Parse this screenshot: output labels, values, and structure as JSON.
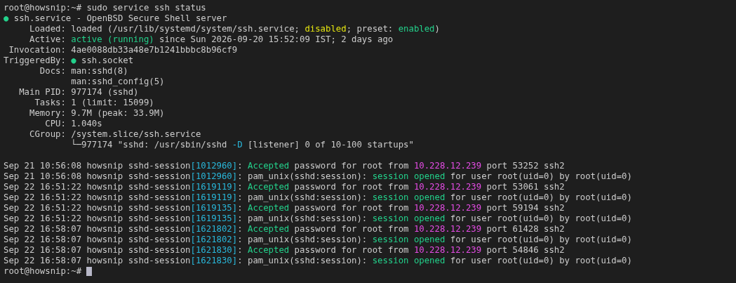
{
  "terminal": {
    "lines": [
      {
        "segments": [
          {
            "text": "root@howsnip:~# sudo service ssh status",
            "kind": "plain"
          }
        ]
      },
      {
        "segments": [
          {
            "text": "●",
            "kind": "ok"
          },
          {
            "text": " ssh.service - OpenBSD Secure Shell server",
            "kind": "plain"
          }
        ]
      },
      {
        "segments": [
          {
            "text": "     Loaded: loaded (/usr/lib/systemd/system/ssh.service; ",
            "kind": "plain"
          },
          {
            "text": "disabled",
            "kind": "warn"
          },
          {
            "text": "; preset: ",
            "kind": "plain"
          },
          {
            "text": "enabled",
            "kind": "ok"
          },
          {
            "text": ")",
            "kind": "plain"
          }
        ]
      },
      {
        "segments": [
          {
            "text": "     Active: ",
            "kind": "plain"
          },
          {
            "text": "active (running)",
            "kind": "ok"
          },
          {
            "text": " since Sun 2026-09-20 15:52:09 IST; 2 days ago",
            "kind": "plain"
          }
        ]
      },
      {
        "segments": [
          {
            "text": " Invocation: 4ae0088db33a48e7b1241bbbc8b96cf9",
            "kind": "plain"
          }
        ]
      },
      {
        "segments": [
          {
            "text": "TriggeredBy: ",
            "kind": "plain"
          },
          {
            "text": "●",
            "kind": "ok"
          },
          {
            "text": " ssh.socket",
            "kind": "plain"
          }
        ]
      },
      {
        "segments": [
          {
            "text": "       Docs: man:sshd(8)",
            "kind": "plain"
          }
        ]
      },
      {
        "segments": [
          {
            "text": "             man:sshd_config(5)",
            "kind": "plain"
          }
        ]
      },
      {
        "segments": [
          {
            "text": "   Main PID: 977174 (sshd)",
            "kind": "plain"
          }
        ]
      },
      {
        "segments": [
          {
            "text": "      Tasks: 1 (limit: 15099)",
            "kind": "plain"
          }
        ]
      },
      {
        "segments": [
          {
            "text": "     Memory: 9.7M (peak: 33.9M)",
            "kind": "plain"
          }
        ]
      },
      {
        "segments": [
          {
            "text": "        CPU: 1.040s",
            "kind": "plain"
          }
        ]
      },
      {
        "segments": [
          {
            "text": "     CGroup: /system.slice/ssh.service",
            "kind": "plain"
          }
        ]
      },
      {
        "segments": [
          {
            "text": "             └─977174 \"sshd: /usr/sbin/sshd ",
            "kind": "plain"
          },
          {
            "text": "-D",
            "kind": "pid"
          },
          {
            "text": " [listener] 0 of 10-100 startups\"",
            "kind": "plain"
          }
        ]
      }
    ],
    "log_lines": [
      {
        "segments": [
          {
            "text": "Sep 21 10:56:08 howsnip sshd-session",
            "kind": "plain"
          },
          {
            "text": "[1012960]",
            "kind": "pid"
          },
          {
            "text": ": ",
            "kind": "plain"
          },
          {
            "text": "Accepted",
            "kind": "ok"
          },
          {
            "text": " password for root from ",
            "kind": "plain"
          },
          {
            "text": "10.228.12.239",
            "kind": "addr"
          },
          {
            "text": " port 53252 ssh2",
            "kind": "plain"
          }
        ]
      },
      {
        "segments": [
          {
            "text": "Sep 21 10:56:08 howsnip sshd-session",
            "kind": "plain"
          },
          {
            "text": "[1012960]",
            "kind": "pid"
          },
          {
            "text": ": pam_unix(sshd:session): ",
            "kind": "plain"
          },
          {
            "text": "session opened",
            "kind": "ok"
          },
          {
            "text": " for user root(uid=0) by root(uid=0)",
            "kind": "plain"
          }
        ]
      },
      {
        "segments": [
          {
            "text": "Sep 22 16:51:22 howsnip sshd-session",
            "kind": "plain"
          },
          {
            "text": "[1619119]",
            "kind": "pid"
          },
          {
            "text": ": ",
            "kind": "plain"
          },
          {
            "text": "Accepted",
            "kind": "ok"
          },
          {
            "text": " password for root from ",
            "kind": "plain"
          },
          {
            "text": "10.228.12.239",
            "kind": "addr"
          },
          {
            "text": " port 53061 ssh2",
            "kind": "plain"
          }
        ]
      },
      {
        "segments": [
          {
            "text": "Sep 22 16:51:22 howsnip sshd-session",
            "kind": "plain"
          },
          {
            "text": "[1619119]",
            "kind": "pid"
          },
          {
            "text": ": pam_unix(sshd:session): ",
            "kind": "plain"
          },
          {
            "text": "session opened",
            "kind": "ok"
          },
          {
            "text": " for user root(uid=0) by root(uid=0)",
            "kind": "plain"
          }
        ]
      },
      {
        "segments": [
          {
            "text": "Sep 22 16:51:22 howsnip sshd-session",
            "kind": "plain"
          },
          {
            "text": "[1619135]",
            "kind": "pid"
          },
          {
            "text": ": ",
            "kind": "plain"
          },
          {
            "text": "Accepted",
            "kind": "ok"
          },
          {
            "text": " password for root from ",
            "kind": "plain"
          },
          {
            "text": "10.228.12.239",
            "kind": "addr"
          },
          {
            "text": " port 59194 ssh2",
            "kind": "plain"
          }
        ]
      },
      {
        "segments": [
          {
            "text": "Sep 22 16:51:22 howsnip sshd-session",
            "kind": "plain"
          },
          {
            "text": "[1619135]",
            "kind": "pid"
          },
          {
            "text": ": pam_unix(sshd:session): ",
            "kind": "plain"
          },
          {
            "text": "session opened",
            "kind": "ok"
          },
          {
            "text": " for user root(uid=0) by root(uid=0)",
            "kind": "plain"
          }
        ]
      },
      {
        "segments": [
          {
            "text": "Sep 22 16:58:07 howsnip sshd-session",
            "kind": "plain"
          },
          {
            "text": "[1621802]",
            "kind": "pid"
          },
          {
            "text": ": ",
            "kind": "plain"
          },
          {
            "text": "Accepted",
            "kind": "ok"
          },
          {
            "text": " password for root from ",
            "kind": "plain"
          },
          {
            "text": "10.228.12.239",
            "kind": "addr"
          },
          {
            "text": " port 61428 ssh2",
            "kind": "plain"
          }
        ]
      },
      {
        "segments": [
          {
            "text": "Sep 22 16:58:07 howsnip sshd-session",
            "kind": "plain"
          },
          {
            "text": "[1621802]",
            "kind": "pid"
          },
          {
            "text": ": pam_unix(sshd:session): ",
            "kind": "plain"
          },
          {
            "text": "session opened",
            "kind": "ok"
          },
          {
            "text": " for user root(uid=0) by root(uid=0)",
            "kind": "plain"
          }
        ]
      },
      {
        "segments": [
          {
            "text": "Sep 22 16:58:07 howsnip sshd-session",
            "kind": "plain"
          },
          {
            "text": "[1621830]",
            "kind": "pid"
          },
          {
            "text": ": ",
            "kind": "plain"
          },
          {
            "text": "Accepted",
            "kind": "ok"
          },
          {
            "text": " password for root from ",
            "kind": "plain"
          },
          {
            "text": "10.228.12.239",
            "kind": "addr"
          },
          {
            "text": " port 54846 ssh2",
            "kind": "plain"
          }
        ]
      },
      {
        "segments": [
          {
            "text": "Sep 22 16:58:07 howsnip sshd-session",
            "kind": "plain"
          },
          {
            "text": "[1621830]",
            "kind": "pid"
          },
          {
            "text": ": pam_unix(sshd:session): ",
            "kind": "plain"
          },
          {
            "text": "session opened",
            "kind": "ok"
          },
          {
            "text": " for user root(uid=0) by root(uid=0)",
            "kind": "plain"
          }
        ]
      }
    ],
    "prompt": {
      "text": "root@howsnip:~#"
    }
  }
}
